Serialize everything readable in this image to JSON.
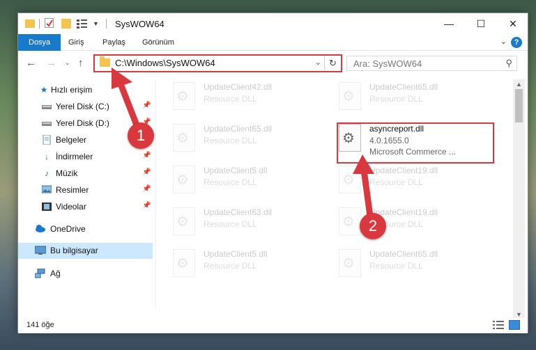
{
  "window": {
    "title": "SysWOW64",
    "minimize": "—",
    "maximize": "☐",
    "close": "✕"
  },
  "ribbon": {
    "tabs": [
      {
        "label": "Dosya",
        "active": true
      },
      {
        "label": "Giriş"
      },
      {
        "label": "Paylaş"
      },
      {
        "label": "Görünüm"
      }
    ],
    "help": "?"
  },
  "nav": {
    "address": "C:\\Windows\\SysWOW64",
    "search_placeholder": "Ara: SysWOW64"
  },
  "sidebar": {
    "items": [
      {
        "label": "Hızlı erişim",
        "icon": "star-icon",
        "pinned": false
      },
      {
        "label": "Yerel Disk (C:)",
        "icon": "drive-icon",
        "pinned": true
      },
      {
        "label": "Yerel Disk (D:)",
        "icon": "drive-icon",
        "pinned": true
      },
      {
        "label": "Belgeler",
        "icon": "documents-icon",
        "pinned": true
      },
      {
        "label": "İndirmeler",
        "icon": "download-icon",
        "pinned": true
      },
      {
        "label": "Müzik",
        "icon": "music-icon",
        "pinned": true
      },
      {
        "label": "Resimler",
        "icon": "pictures-icon",
        "pinned": true
      },
      {
        "label": "Videolar",
        "icon": "videos-icon",
        "pinned": true
      },
      {
        "label": "OneDrive",
        "icon": "cloud-icon",
        "pinned": false
      },
      {
        "label": "Bu bilgisayar",
        "icon": "computer-icon",
        "pinned": false,
        "selected": true
      },
      {
        "label": "Ağ",
        "icon": "network-icon",
        "pinned": false
      }
    ]
  },
  "files": [
    {
      "name": "UpdateClient42.dll",
      "sub": "Resource DLL",
      "faded": true
    },
    {
      "name": "UpdateClient65.dll",
      "sub": "Resource DLL",
      "faded": true
    },
    {
      "name": "UpdateClient65.dll",
      "sub": "Resource DLL",
      "faded": true
    },
    {
      "name": "asyncreport.dll",
      "version": "4.0.1655.0",
      "sub": "Microsoft Commerce ...",
      "faded": false
    },
    {
      "name": "UpdateClient5.dll",
      "sub": "Resource DLL",
      "faded": true
    },
    {
      "name": "UpdateClient19.dll",
      "sub": "Resource DLL",
      "faded": true
    },
    {
      "name": "UpdateClient63.dll",
      "sub": "Resource DLL",
      "faded": true
    },
    {
      "name": "UpdateClient19.dll",
      "sub": "Resource DLL",
      "faded": true
    },
    {
      "name": "UpdateClient5.dll",
      "sub": "Resource DLL",
      "faded": true
    },
    {
      "name": "UpdateClient65.dll",
      "sub": "Resource DLL",
      "faded": true
    }
  ],
  "status": {
    "item_count": "141 öğe"
  },
  "annotations": {
    "step1": "1",
    "step2": "2",
    "color": "#d9393e"
  }
}
